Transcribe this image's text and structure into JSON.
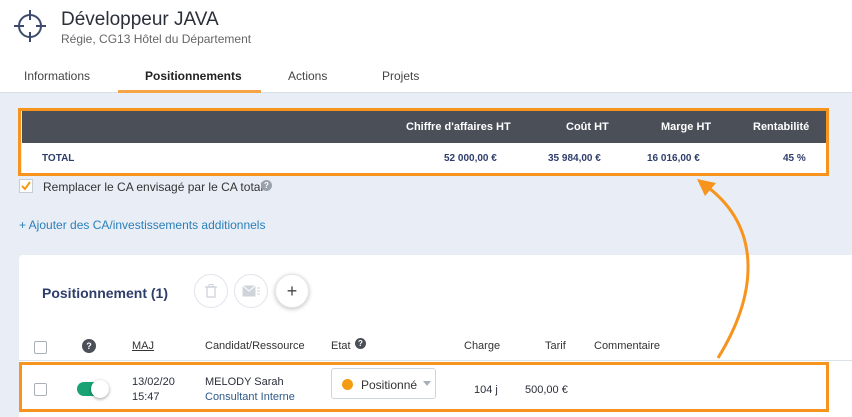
{
  "header": {
    "title": "Développeur JAVA",
    "subtitle": "Régie, CG13 Hôtel du Département"
  },
  "tabs": [
    {
      "label": "Informations",
      "active": false
    },
    {
      "label": "Positionnements",
      "active": true
    },
    {
      "label": "Actions",
      "active": false
    },
    {
      "label": "Projets",
      "active": false
    }
  ],
  "summary": {
    "columns": [
      "Chiffre d'affaires HT",
      "Coût HT",
      "Marge HT",
      "Rentabilité"
    ],
    "total_label": "TOTAL",
    "values": [
      "52 000,00 €",
      "35 984,00 €",
      "16 016,00 €",
      "45 %"
    ]
  },
  "options": {
    "replace_ca_label": "Remplacer le CA envisagé par le CA total",
    "replace_ca_checked": true,
    "help_glyph": "?"
  },
  "add_link": "+ Ajouter des CA/investissements additionnels",
  "positionnement": {
    "title": "Positionnement (1)",
    "plus_label": "+",
    "columns": {
      "help": "?",
      "maj": "MAJ",
      "candidat": "Candidat/Ressource",
      "etat": "Etat",
      "charge": "Charge",
      "tarif": "Tarif",
      "commentaire": "Commentaire"
    },
    "rows": [
      {
        "date": "13/02/20",
        "time": "15:47",
        "name": "MELODY Sarah",
        "role": "Consultant Interne",
        "status": "Positionné",
        "charge": "104 j",
        "tarif": "500,00 €",
        "commentaire": ""
      }
    ]
  },
  "colors": {
    "highlight": "#f7941d",
    "tab_accent": "#f5a545",
    "toggle_on": "#19a374",
    "status_dot": "#f39c12",
    "link": "#2a7fb8",
    "table_header": "#4a4f58"
  }
}
